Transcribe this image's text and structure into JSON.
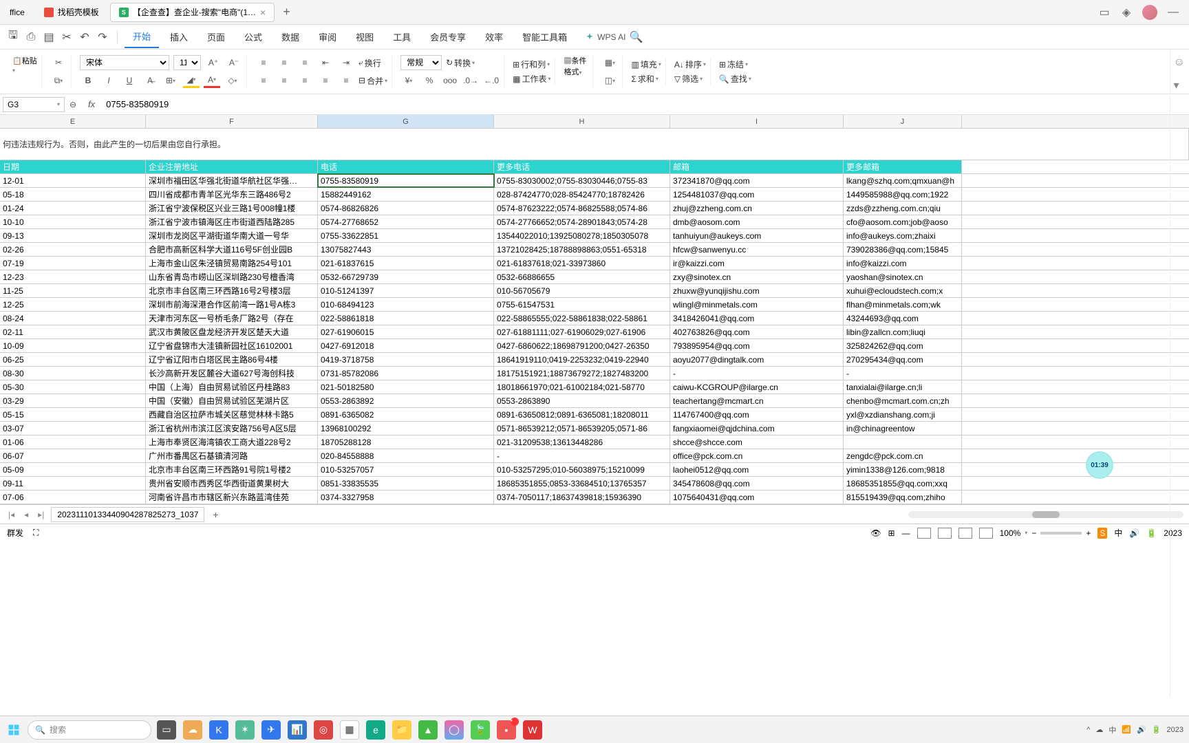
{
  "tabs": {
    "t0": "ffice",
    "t1": "找稻壳模板",
    "t2": "【企查查】查企业-搜索\"电商\"(1…"
  },
  "menubar": {
    "items": [
      "开始",
      "插入",
      "页面",
      "公式",
      "数据",
      "审阅",
      "视图",
      "工具",
      "会员专享",
      "效率",
      "智能工具箱"
    ],
    "wpsai": "WPS AI"
  },
  "ribbon": {
    "paste": "粘贴",
    "font": "宋体",
    "size": "11",
    "wrap": "换行",
    "merge": "合并",
    "numfmt": "常规",
    "convert": "转换",
    "rowcol": "行和列",
    "worksheet": "工作表",
    "condfmt": "条件格式",
    "fill": "填充",
    "sort": "排序",
    "freeze": "冻结",
    "sum": "求和",
    "filter": "筛选",
    "find": "查找"
  },
  "formula": {
    "namebox": "G3",
    "value": "0755-83580919"
  },
  "colhdrs": [
    "E",
    "F",
    "G",
    "H",
    "I",
    "J"
  ],
  "note": "何违法违规行为。否则，由此产生的一切后果由您自行承担。",
  "headers": {
    "e": "日期",
    "f": "企业注册地址",
    "g": "电话",
    "h": "更多电话",
    "i": "邮箱",
    "j": "更多邮箱"
  },
  "rows": [
    {
      "e": "12-01",
      "f": "深圳市福田区华强北街道华航社区华强…",
      "g": "0755-83580919",
      "h": "0755-83030002;0755-83030446;0755-83",
      "i": "372341870@qq.com",
      "j": "lkang@szhq.com;qmxuan@h"
    },
    {
      "e": "05-18",
      "f": "四川省成都市青羊区光华东三路486号2",
      "g": "15882449162",
      "h": "028-87424770;028-85424770;18782426",
      "i": "1254481037@qq.com",
      "j": "1449585988@qq.com;1922"
    },
    {
      "e": "01-24",
      "f": "浙江省宁波保税区兴业三路1号008幢1楼",
      "g": "0574-86826826",
      "h": "0574-87623222;0574-86825588;0574-86",
      "i": "zhuj@zzheng.com.cn",
      "j": "zzds@zzheng.com.cn;qiu"
    },
    {
      "e": "10-10",
      "f": "浙江省宁波市镇海区庄市街道西陆路285",
      "g": "0574-27768652",
      "h": "0574-27766652;0574-28901843;0574-28",
      "i": "dmb@aosom.com",
      "j": "cfo@aosom.com;job@aoso"
    },
    {
      "e": "09-13",
      "f": "深圳市龙岗区平湖街道华南大道一号华",
      "g": "0755-33622851",
      "h": "13544022010;13925080278;1850305078",
      "i": "tanhuiyun@aukeys.com",
      "j": "info@aukeys.com;zhaixi"
    },
    {
      "e": "02-26",
      "f": "合肥市高新区科学大道116号5F创业园B",
      "g": "13075827443",
      "h": "13721028425;18788898863;0551-65318",
      "i": "hfcw@sanwenyu.cc",
      "j": "739028386@qq.com;15845"
    },
    {
      "e": "07-19",
      "f": "上海市金山区朱泾镇贸易南路254号101",
      "g": "021-61837615",
      "h": "021-61837618;021-33973860",
      "i": "ir@kaizzi.com",
      "j": "info@kaizzi.com"
    },
    {
      "e": "12-23",
      "f": "山东省青岛市崂山区深圳路230号檀香湾",
      "g": "0532-66729739",
      "h": "0532-66886655",
      "i": "zxy@sinotex.cn",
      "j": "yaoshan@sinotex.cn"
    },
    {
      "e": "11-25",
      "f": "北京市丰台区南三环西路16号2号楼3层",
      "g": "010-51241397",
      "h": "010-56705679",
      "i": "zhuxw@yunqijishu.com",
      "j": "xuhui@ecloudstech.com;x"
    },
    {
      "e": "12-25",
      "f": "深圳市前海深港合作区前湾一路1号A栋3",
      "g": "010-68494123",
      "h": "0755-61547531",
      "i": "wlingl@minmetals.com",
      "j": "flhan@minmetals.com;wk"
    },
    {
      "e": "08-24",
      "f": "天津市河东区一号桥毛条厂路2号（存在",
      "g": "022-58861818",
      "h": "022-58865555;022-58861838;022-58861",
      "i": "3418426041@qq.com",
      "j": "43244693@qq.com"
    },
    {
      "e": "02-11",
      "f": "武汉市黄陂区盘龙经济开发区楚天大道",
      "g": "027-61906015",
      "h": "027-61881111;027-61906029;027-61906",
      "i": "402763826@qq.com",
      "j": "libin@zallcn.com;liuqi"
    },
    {
      "e": "10-09",
      "f": "辽宁省盘锦市大洼镇新园社区16102001",
      "g": "0427-6912018",
      "h": "0427-6860622;18698791200;0427-26350",
      "i": "793895954@qq.com",
      "j": "325824262@qq.com"
    },
    {
      "e": "06-25",
      "f": "辽宁省辽阳市白塔区民主路86号4楼",
      "g": "0419-3718758",
      "h": "18641919110;0419-2253232;0419-22940",
      "i": "aoyu2077@dingtalk.com",
      "j": "270295434@qq.com"
    },
    {
      "e": "08-30",
      "f": "长沙高新开发区麓谷大道627号海创科技",
      "g": "0731-85782086",
      "h": "18175151921;18873679272;1827483200",
      "i": "-",
      "j": "-"
    },
    {
      "e": "05-30",
      "f": "中国（上海）自由贸易试验区丹桂路83",
      "g": "021-50182580",
      "h": "18018661970;021-61002184;021-58770",
      "i": "caiwu-KCGROUP@ilarge.cn",
      "j": "tanxialai@ilarge.cn;li"
    },
    {
      "e": "03-29",
      "f": "中国（安徽）自由贸易试验区芜湖片区",
      "g": "0553-2863892",
      "h": "0553-2863890",
      "i": "teachertang@mcmart.cn",
      "j": "chenbo@mcmart.com.cn;zh"
    },
    {
      "e": "05-15",
      "f": "西藏自治区拉萨市城关区慈觉林林卡路5",
      "g": "0891-6365082",
      "h": "0891-63650812;0891-6365081;18208011",
      "i": "114767400@qq.com",
      "j": "yxl@xzdianshang.com;ji"
    },
    {
      "e": "03-07",
      "f": "浙江省杭州市滨江区滨安路756号A区5层",
      "g": "13968100292",
      "h": "0571-86539212;0571-86539205;0571-86",
      "i": "fangxiaomei@qjdchina.com",
      "j": "in@chinagreentow"
    },
    {
      "e": "01-06",
      "f": "上海市奉贤区海湾镇农工商大道228号2",
      "g": "18705288128",
      "h": "021-31209538;13613448286",
      "i": "shcce@shcce.com",
      "j": ""
    },
    {
      "e": "06-07",
      "f": "广州市番禺区石基镇清河路",
      "g": "020-84558888",
      "h": "-",
      "i": "office@pck.com.cn",
      "j": "zengdc@pck.com.cn"
    },
    {
      "e": "05-09",
      "f": "北京市丰台区南三环西路91号院1号楼2",
      "g": "010-53257057",
      "h": "010-53257295;010-56038975;15210099",
      "i": "laohei0512@qq.com",
      "j": "yimin1338@126.com;9818"
    },
    {
      "e": "09-11",
      "f": "贵州省安顺市西秀区华西街道黄果树大",
      "g": "0851-33835535",
      "h": "18685351855;0853-33684510;13765357",
      "i": "345478608@qq.com",
      "j": "18685351855@qq.com;xxq"
    },
    {
      "e": "07-06",
      "f": "河南省许昌市市辖区新兴东路蓝湾佳苑",
      "g": "0374-3327958",
      "h": "0374-7050117;18637439818;15936390",
      "i": "1075640431@qq.com",
      "j": "815519439@qq.com;zhiho"
    }
  ],
  "sheettab": "20231110133440904287825273_1037",
  "statusbar": {
    "left1": "群发",
    "zoom": "100%"
  },
  "taskbar": {
    "search": "搜索",
    "time": "2023"
  },
  "timer": "01:39"
}
